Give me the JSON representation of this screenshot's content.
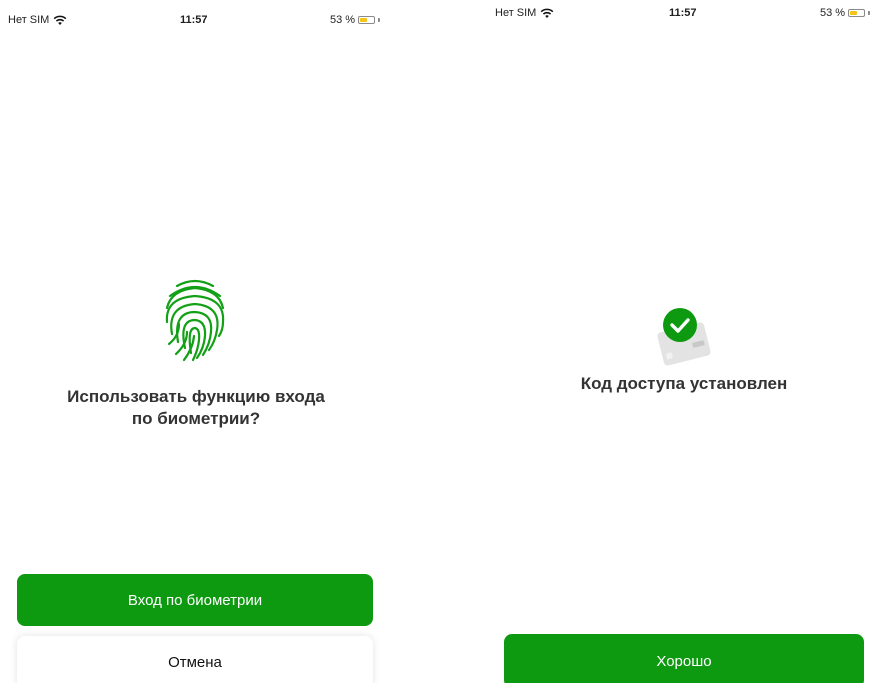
{
  "left_screen": {
    "status_bar": {
      "carrier": "Нет SIM",
      "time": "11:57",
      "battery_percent": "53 %",
      "battery_level": 0.53,
      "battery_color": "#f5c518"
    },
    "question_line1": "Использовать функцию входа",
    "question_line2": "по биометрии?",
    "primary_button": "Вход по биометрии",
    "cancel_button": "Отмена"
  },
  "right_screen": {
    "status_bar": {
      "carrier": "Нет SIM",
      "time": "11:57",
      "battery_percent": "53 %",
      "battery_level": 0.53,
      "battery_color": "#f5c518"
    },
    "message": "Код доступа установлен",
    "ok_button": "Хорошо"
  },
  "icons": {
    "wifi": "wifi-icon",
    "fingerprint": "fingerprint-icon",
    "card_check": "card-check-icon"
  },
  "colors": {
    "accent": "#0e9a10",
    "fingerprint": "#13a016"
  }
}
